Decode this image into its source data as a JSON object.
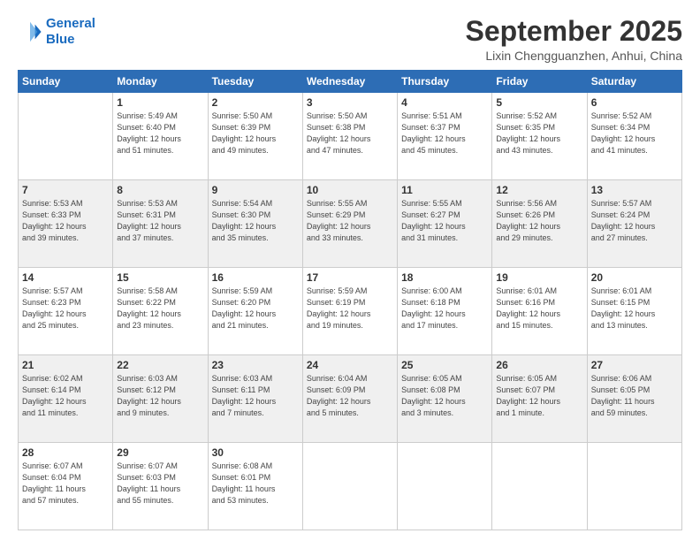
{
  "logo": {
    "line1": "General",
    "line2": "Blue"
  },
  "title": "September 2025",
  "location": "Lixin Chengguanzhen, Anhui, China",
  "weekdays": [
    "Sunday",
    "Monday",
    "Tuesday",
    "Wednesday",
    "Thursday",
    "Friday",
    "Saturday"
  ],
  "weeks": [
    [
      {
        "day": "",
        "info": ""
      },
      {
        "day": "1",
        "info": "Sunrise: 5:49 AM\nSunset: 6:40 PM\nDaylight: 12 hours\nand 51 minutes."
      },
      {
        "day": "2",
        "info": "Sunrise: 5:50 AM\nSunset: 6:39 PM\nDaylight: 12 hours\nand 49 minutes."
      },
      {
        "day": "3",
        "info": "Sunrise: 5:50 AM\nSunset: 6:38 PM\nDaylight: 12 hours\nand 47 minutes."
      },
      {
        "day": "4",
        "info": "Sunrise: 5:51 AM\nSunset: 6:37 PM\nDaylight: 12 hours\nand 45 minutes."
      },
      {
        "day": "5",
        "info": "Sunrise: 5:52 AM\nSunset: 6:35 PM\nDaylight: 12 hours\nand 43 minutes."
      },
      {
        "day": "6",
        "info": "Sunrise: 5:52 AM\nSunset: 6:34 PM\nDaylight: 12 hours\nand 41 minutes."
      }
    ],
    [
      {
        "day": "7",
        "info": "Sunrise: 5:53 AM\nSunset: 6:33 PM\nDaylight: 12 hours\nand 39 minutes."
      },
      {
        "day": "8",
        "info": "Sunrise: 5:53 AM\nSunset: 6:31 PM\nDaylight: 12 hours\nand 37 minutes."
      },
      {
        "day": "9",
        "info": "Sunrise: 5:54 AM\nSunset: 6:30 PM\nDaylight: 12 hours\nand 35 minutes."
      },
      {
        "day": "10",
        "info": "Sunrise: 5:55 AM\nSunset: 6:29 PM\nDaylight: 12 hours\nand 33 minutes."
      },
      {
        "day": "11",
        "info": "Sunrise: 5:55 AM\nSunset: 6:27 PM\nDaylight: 12 hours\nand 31 minutes."
      },
      {
        "day": "12",
        "info": "Sunrise: 5:56 AM\nSunset: 6:26 PM\nDaylight: 12 hours\nand 29 minutes."
      },
      {
        "day": "13",
        "info": "Sunrise: 5:57 AM\nSunset: 6:24 PM\nDaylight: 12 hours\nand 27 minutes."
      }
    ],
    [
      {
        "day": "14",
        "info": "Sunrise: 5:57 AM\nSunset: 6:23 PM\nDaylight: 12 hours\nand 25 minutes."
      },
      {
        "day": "15",
        "info": "Sunrise: 5:58 AM\nSunset: 6:22 PM\nDaylight: 12 hours\nand 23 minutes."
      },
      {
        "day": "16",
        "info": "Sunrise: 5:59 AM\nSunset: 6:20 PM\nDaylight: 12 hours\nand 21 minutes."
      },
      {
        "day": "17",
        "info": "Sunrise: 5:59 AM\nSunset: 6:19 PM\nDaylight: 12 hours\nand 19 minutes."
      },
      {
        "day": "18",
        "info": "Sunrise: 6:00 AM\nSunset: 6:18 PM\nDaylight: 12 hours\nand 17 minutes."
      },
      {
        "day": "19",
        "info": "Sunrise: 6:01 AM\nSunset: 6:16 PM\nDaylight: 12 hours\nand 15 minutes."
      },
      {
        "day": "20",
        "info": "Sunrise: 6:01 AM\nSunset: 6:15 PM\nDaylight: 12 hours\nand 13 minutes."
      }
    ],
    [
      {
        "day": "21",
        "info": "Sunrise: 6:02 AM\nSunset: 6:14 PM\nDaylight: 12 hours\nand 11 minutes."
      },
      {
        "day": "22",
        "info": "Sunrise: 6:03 AM\nSunset: 6:12 PM\nDaylight: 12 hours\nand 9 minutes."
      },
      {
        "day": "23",
        "info": "Sunrise: 6:03 AM\nSunset: 6:11 PM\nDaylight: 12 hours\nand 7 minutes."
      },
      {
        "day": "24",
        "info": "Sunrise: 6:04 AM\nSunset: 6:09 PM\nDaylight: 12 hours\nand 5 minutes."
      },
      {
        "day": "25",
        "info": "Sunrise: 6:05 AM\nSunset: 6:08 PM\nDaylight: 12 hours\nand 3 minutes."
      },
      {
        "day": "26",
        "info": "Sunrise: 6:05 AM\nSunset: 6:07 PM\nDaylight: 12 hours\nand 1 minute."
      },
      {
        "day": "27",
        "info": "Sunrise: 6:06 AM\nSunset: 6:05 PM\nDaylight: 11 hours\nand 59 minutes."
      }
    ],
    [
      {
        "day": "28",
        "info": "Sunrise: 6:07 AM\nSunset: 6:04 PM\nDaylight: 11 hours\nand 57 minutes."
      },
      {
        "day": "29",
        "info": "Sunrise: 6:07 AM\nSunset: 6:03 PM\nDaylight: 11 hours\nand 55 minutes."
      },
      {
        "day": "30",
        "info": "Sunrise: 6:08 AM\nSunset: 6:01 PM\nDaylight: 11 hours\nand 53 minutes."
      },
      {
        "day": "",
        "info": ""
      },
      {
        "day": "",
        "info": ""
      },
      {
        "day": "",
        "info": ""
      },
      {
        "day": "",
        "info": ""
      }
    ]
  ]
}
